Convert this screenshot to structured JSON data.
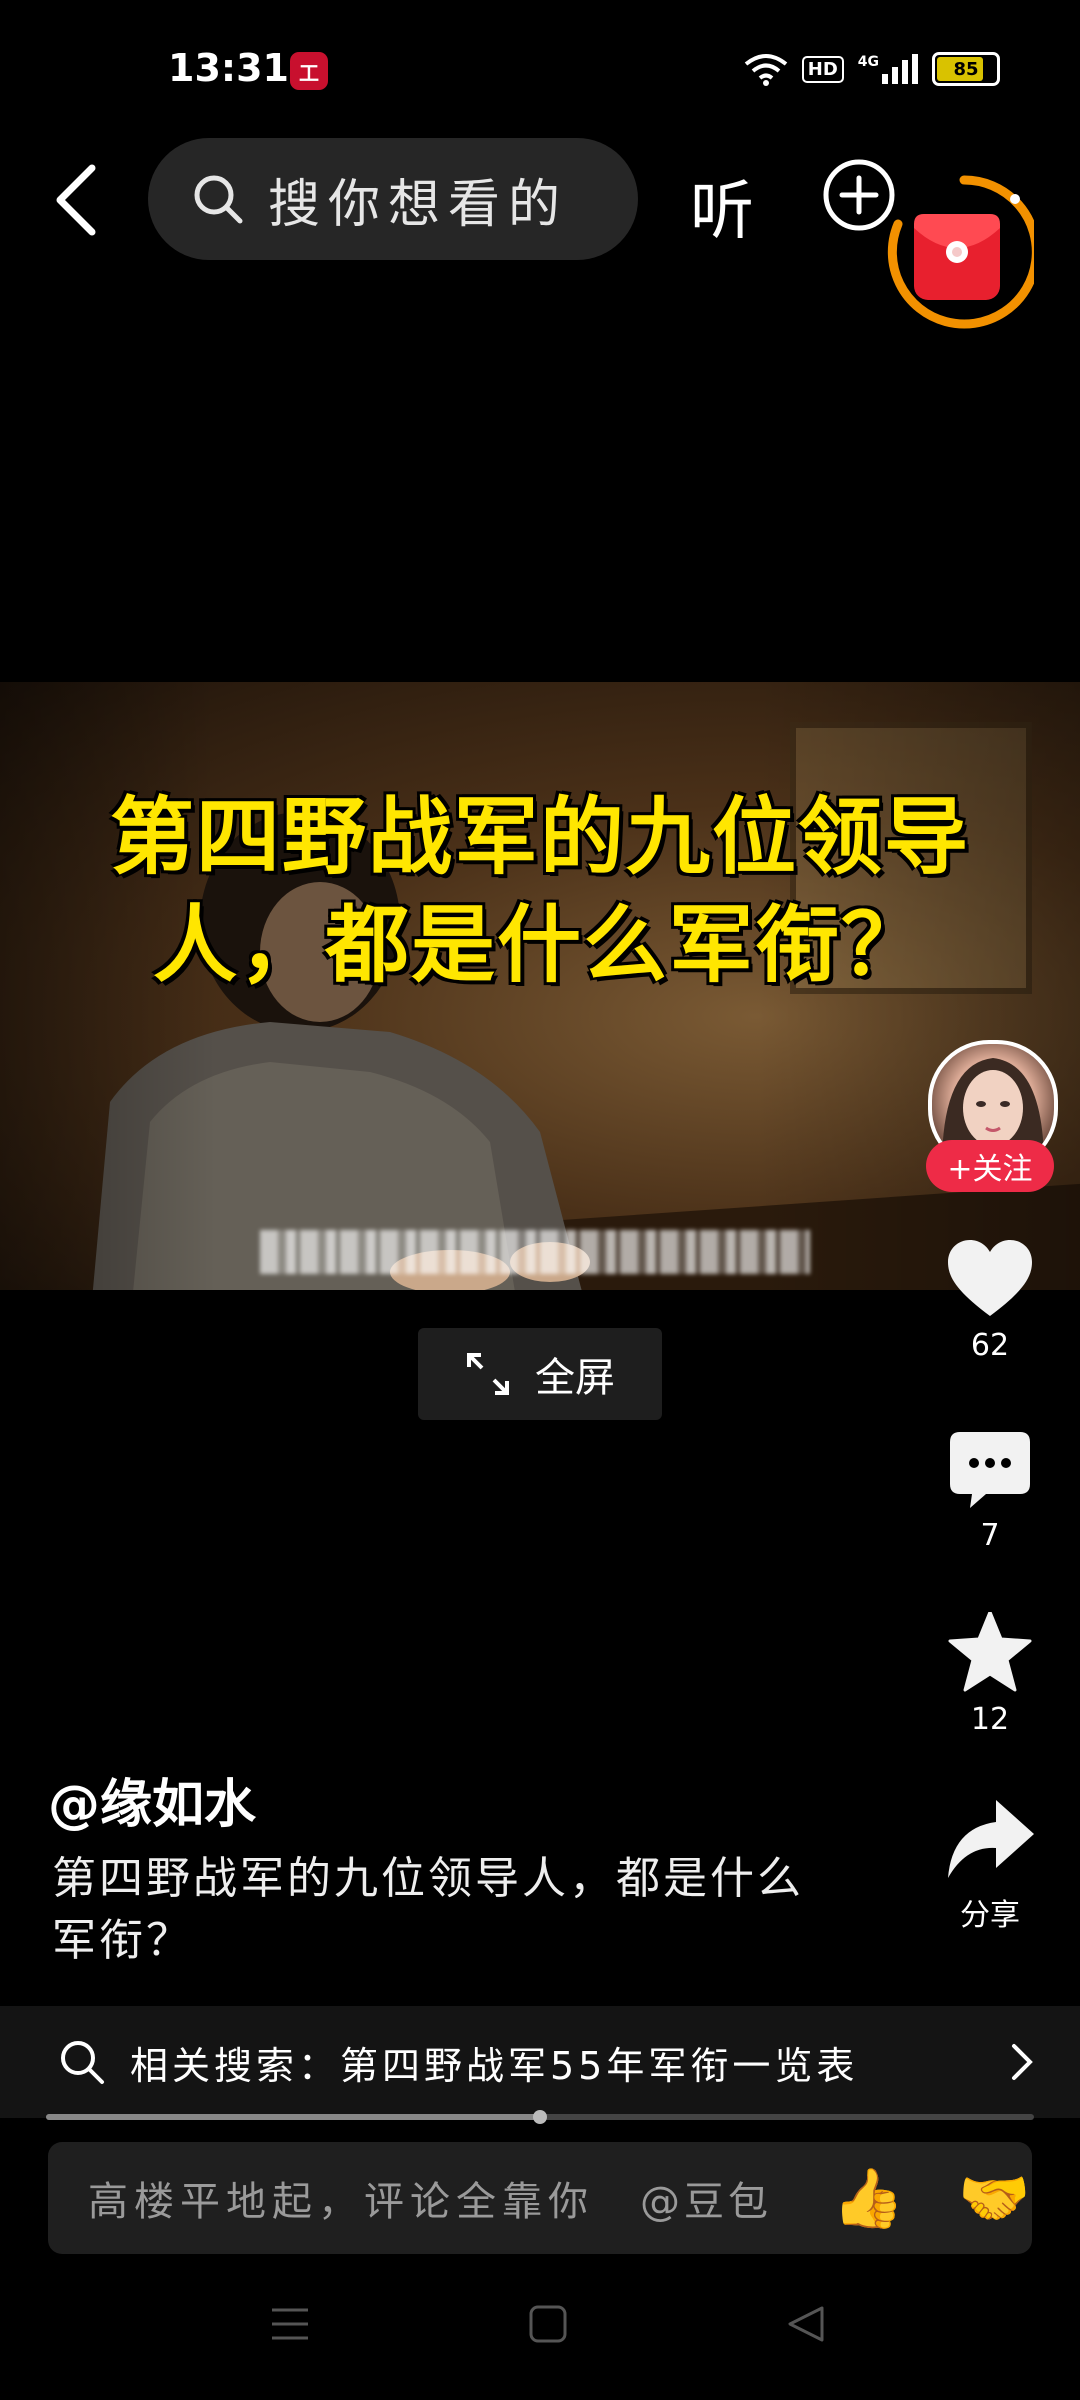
{
  "status_bar": {
    "time": "13:31",
    "app_icon": "bank-app-icon",
    "hd_label": "HD",
    "network": "4G",
    "battery": "85",
    "battery_level": 0.85
  },
  "top_bar": {
    "search_placeholder": "搜你想看的",
    "listen_label": "听"
  },
  "video": {
    "title_line1": "第四野战军的九位领导",
    "title_line2": "人，都是什么军衔？",
    "fullscreen_label": "全屏"
  },
  "right_rail": {
    "follow_label": "+关注",
    "like_count": "62",
    "comment_count": "7",
    "favorite_count": "12",
    "share_label": "分享"
  },
  "post": {
    "author": "@缘如水",
    "caption": "第四野战军的九位领导人，都是什么军衔？"
  },
  "related_search": {
    "text": "相关搜索：第四野战军55年军衔一览表"
  },
  "playback": {
    "progress": 0.5
  },
  "comment_bar": {
    "placeholder": "高楼平地起，评论全靠你",
    "mention": "@豆包",
    "emoji_1": "👍",
    "emoji_2": "🤝"
  },
  "colors": {
    "accent_red": "#ee2b47",
    "title_yellow": "#ffe600",
    "ring_orange": "#f29100"
  }
}
